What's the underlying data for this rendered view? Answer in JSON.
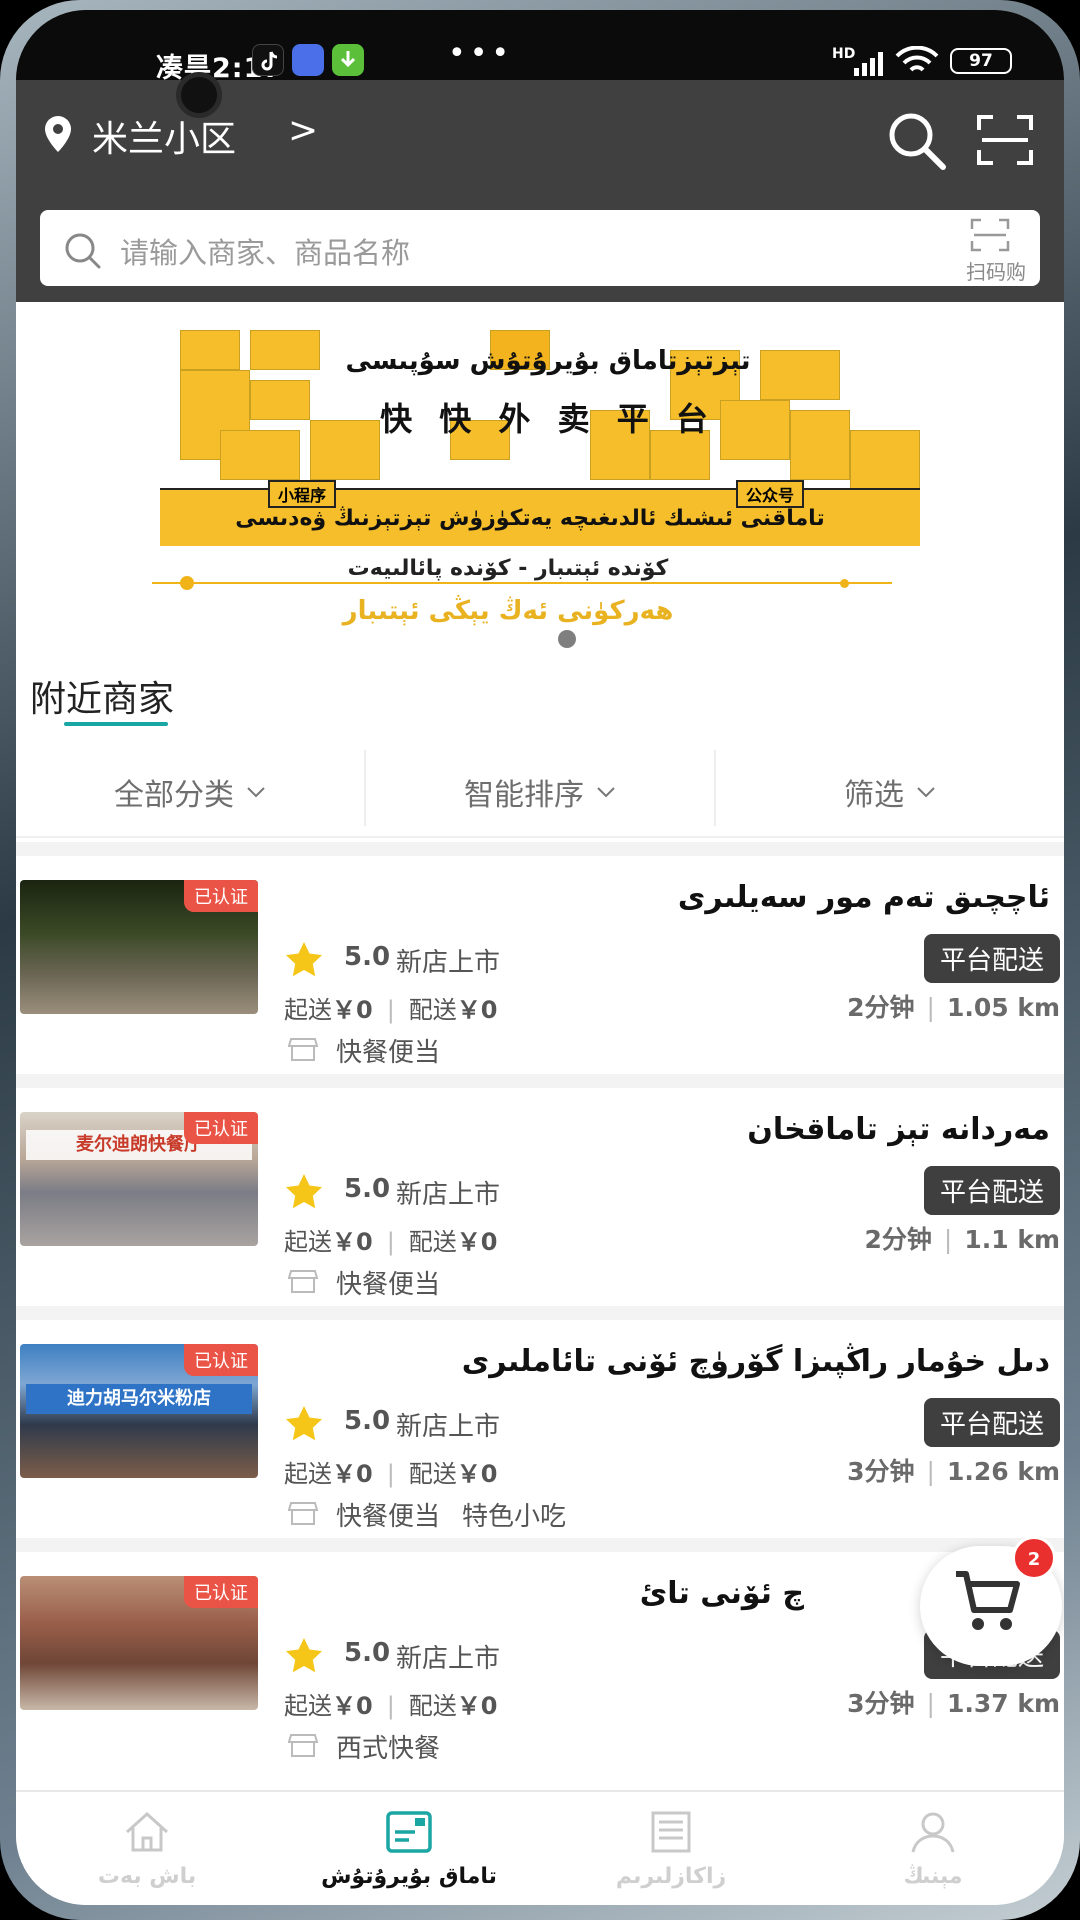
{
  "status_bar": {
    "time": "2:17",
    "carrier_prefix": "凑昙",
    "network": "HD",
    "battery": "97"
  },
  "header": {
    "location": "米兰小区",
    "location_chevron": ">",
    "search_placeholder": "请输入商家、商品名称",
    "scan_label": "扫码购"
  },
  "banner": {
    "line1": "تېزتېزتاماق بۇيرۇتۇش سۇپىسى",
    "line2": "快 快 外 卖 平 台",
    "tag_left": "小程序",
    "tag_right": "公众号",
    "line3": "تاماقنى ئىشىك ئالدىغىچە يەتكۈزۈش تېزتېزنىڭ ۋەدىسى",
    "line4": "كۆندە ئېتىبار - كۆندە پائالىيەت",
    "line5": "ھەركۈنى ئەڭ يېڭى ئېتىبار"
  },
  "section": {
    "title": "附近商家"
  },
  "filters": [
    "全部分类",
    "智能排序",
    "筛选"
  ],
  "merchants": [
    {
      "name": "ئاچچىق تەم مور سەيلىرى",
      "verified": "已认证",
      "rating": "5.0",
      "new_tag": "新店上市",
      "delivery": "平台配送",
      "min_order_label": "起送",
      "min_order": "￥0",
      "fee_label": "配送",
      "fee": "￥0",
      "time": "2分钟",
      "distance": "1.05 km",
      "categories": [
        "快餐便当"
      ],
      "sign": ""
    },
    {
      "name": "مەردانە تېز تاماقخان",
      "verified": "已认证",
      "rating": "5.0",
      "new_tag": "新店上市",
      "delivery": "平台配送",
      "min_order_label": "起送",
      "min_order": "￥0",
      "fee_label": "配送",
      "fee": "￥0",
      "time": "2分钟",
      "distance": "1.1 km",
      "categories": [
        "快餐便当"
      ],
      "sign": "麦尔迪朗快餐厅"
    },
    {
      "name": "دىل خۇمار راڭپىزا گۆرۈچ ئۆنى تائاملىرى",
      "verified": "已认证",
      "rating": "5.0",
      "new_tag": "新店上市",
      "delivery": "平台配送",
      "min_order_label": "起送",
      "min_order": "￥0",
      "fee_label": "配送",
      "fee": "￥0",
      "time": "3分钟",
      "distance": "1.26 km",
      "categories": [
        "快餐便当",
        "特色小吃"
      ],
      "sign": "迪力胡马尔米粉店"
    },
    {
      "name": "چ ئۆنى تائ",
      "verified": "已认证",
      "rating": "5.0",
      "new_tag": "新店上市",
      "delivery": "平台配送",
      "min_order_label": "起送",
      "min_order": "￥0",
      "fee_label": "配送",
      "fee": "￥0",
      "time": "3分钟",
      "distance": "1.37 km",
      "categories": [
        "西式快餐"
      ],
      "sign": ""
    }
  ],
  "cart": {
    "count": "2"
  },
  "bottom_nav": [
    {
      "label": "باش بەت",
      "icon": "home-icon"
    },
    {
      "label": "تاماق بۇيرۇتۇش",
      "icon": "order-food-icon"
    },
    {
      "label": "زاكازلىرىم",
      "icon": "orders-list-icon"
    },
    {
      "label": "مېنىڭ",
      "icon": "profile-icon"
    }
  ],
  "colors": {
    "header_bg": "#404040",
    "accent_teal": "#1aa6a3",
    "verified_red": "#ea5447",
    "banner_yellow": "#f5be2a",
    "star_yellow": "#f5c518",
    "cart_badge": "#ea2f2f"
  }
}
